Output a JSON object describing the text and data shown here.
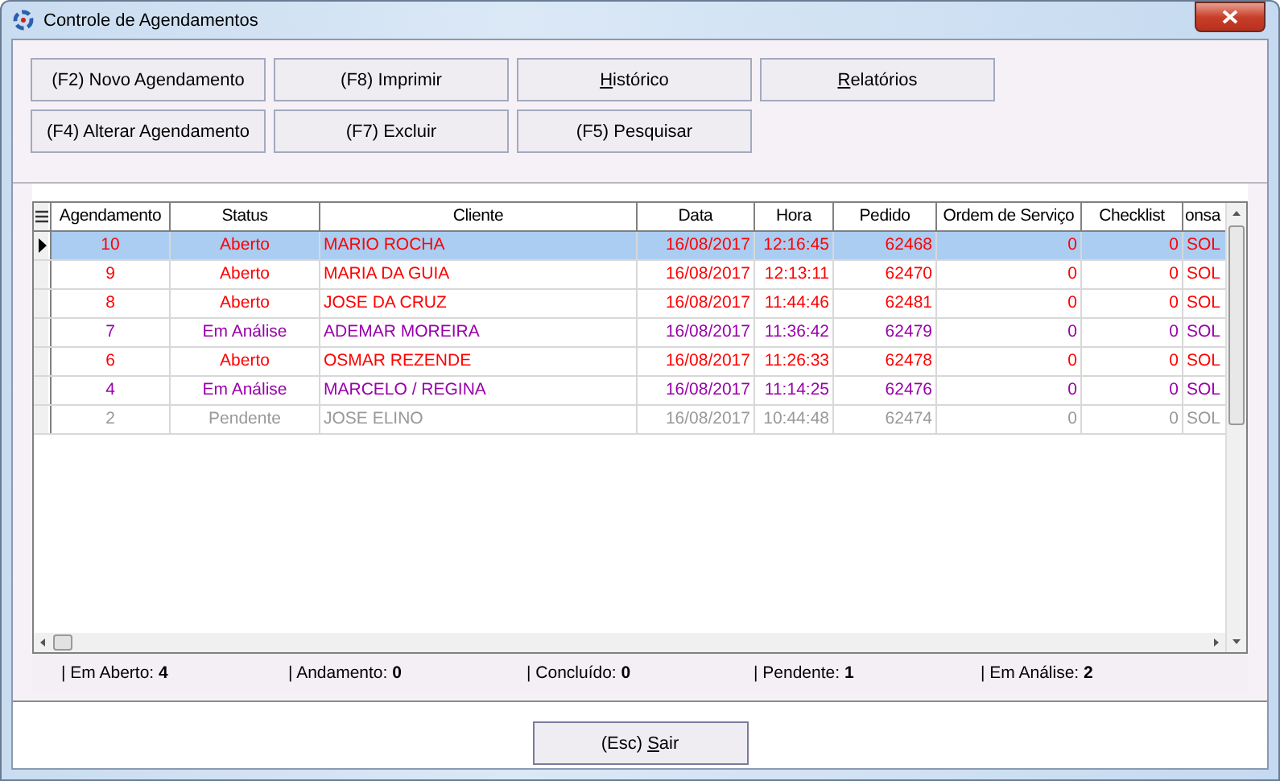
{
  "window": {
    "title": "Controle de Agendamentos"
  },
  "buttons": [
    [
      {
        "pre": "(F2) Novo Agendamento"
      },
      {
        "pre": "(F8) Imprimir"
      },
      {
        "key": "H",
        "post": "istórico"
      },
      {
        "key": "R",
        "post": "elatórios"
      }
    ],
    [
      {
        "pre": "(F4) Alterar Agendamento"
      },
      {
        "pre": "(F7) Excluir"
      },
      {
        "pre": "(F5) Pesquisar"
      }
    ]
  ],
  "table": {
    "columns": [
      "Agendamento",
      "Status",
      "Cliente",
      "Data",
      "Hora",
      "Pedido",
      "Ordem de Serviço",
      "Checklist",
      "onsa"
    ],
    "rows": [
      {
        "selected": true,
        "color": "#ff0000",
        "cells": [
          "10",
          "Aberto",
          "MARIO ROCHA",
          "16/08/2017",
          "12:16:45",
          "62468",
          "0",
          "0",
          "SOL"
        ]
      },
      {
        "selected": false,
        "color": "#ff0000",
        "cells": [
          "9",
          "Aberto",
          "MARIA DA GUIA",
          "16/08/2017",
          "12:13:11",
          "62470",
          "0",
          "0",
          "SOL"
        ]
      },
      {
        "selected": false,
        "color": "#ff0000",
        "cells": [
          "8",
          "Aberto",
          "JOSE DA CRUZ",
          "16/08/2017",
          "11:44:46",
          "62481",
          "0",
          "0",
          "SOL"
        ]
      },
      {
        "selected": false,
        "color": "#9900aa",
        "cells": [
          "7",
          "Em Análise",
          "ADEMAR MOREIRA",
          "16/08/2017",
          "11:36:42",
          "62479",
          "0",
          "0",
          "SOL"
        ]
      },
      {
        "selected": false,
        "color": "#ff0000",
        "cells": [
          "6",
          "Aberto",
          "OSMAR REZENDE",
          "16/08/2017",
          "11:26:33",
          "62478",
          "0",
          "0",
          "SOL"
        ]
      },
      {
        "selected": false,
        "color": "#9900aa",
        "cells": [
          "4",
          "Em Análise",
          "MARCELO / REGINA",
          "16/08/2017",
          "11:14:25",
          "62476",
          "0",
          "0",
          "SOL"
        ]
      },
      {
        "selected": false,
        "color": "#999999",
        "cells": [
          "2",
          "Pendente",
          "JOSE ELINO",
          "16/08/2017",
          "10:44:48",
          "62474",
          "0",
          "0",
          "SOL"
        ]
      }
    ]
  },
  "summary": [
    {
      "label": "| Em Aberto:",
      "value": "4"
    },
    {
      "label": "| Andamento:",
      "value": "0"
    },
    {
      "label": "| Concluído:",
      "value": "0"
    },
    {
      "label": "| Pendente:",
      "value": "1"
    },
    {
      "label": "| Em Análise:",
      "value": "2"
    }
  ],
  "exit_button": {
    "pre": "(Esc) ",
    "key": "S",
    "post": "air"
  }
}
